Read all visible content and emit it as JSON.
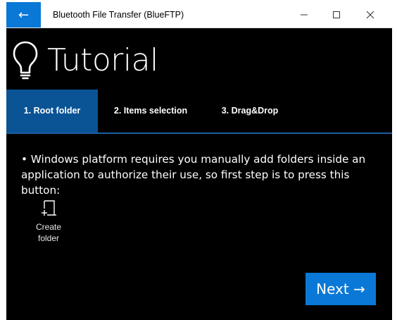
{
  "window": {
    "title": "Bluetooth File Transfer (BlueFTP)",
    "back_glyph": "←",
    "min_glyph": "—",
    "max_glyph": "☐",
    "close_glyph": "✕"
  },
  "header": {
    "title": "Tutorial",
    "icon": "lightbulb-icon"
  },
  "tabs": [
    {
      "label": "1. Root folder",
      "active": true
    },
    {
      "label": "2. Items selection",
      "active": false
    },
    {
      "label": "3. Drag&Drop",
      "active": false
    }
  ],
  "content": {
    "instruction": "• Windows platform requires you manually add folders inside an application to authorize their use, so first step is to press this button:",
    "create_folder": {
      "label_line1": "Create",
      "label_line2": "folder",
      "icon": "add-folder-icon"
    },
    "next_button": "Next →"
  },
  "colors": {
    "accent": "#0a78d7",
    "active_tab": "#0a5394",
    "background": "#000000",
    "text": "#ffffff"
  }
}
